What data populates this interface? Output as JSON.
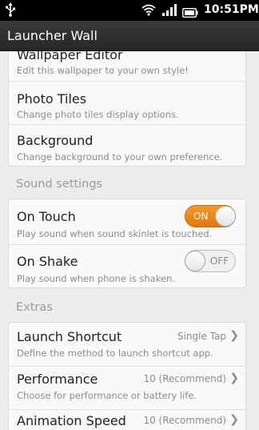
{
  "status_bar": {
    "time": "10:51PM",
    "icons": [
      "usb-icon",
      "wifi-icon",
      "signal-icon",
      "battery-icon"
    ]
  },
  "app": {
    "title": "Launcher Wall"
  },
  "wallpaper_section": {
    "items": [
      {
        "label": "Wallpaper Editor",
        "desc": "Edit this wallpaper to your own style!"
      },
      {
        "label": "Photo Tiles",
        "desc": "Change photo tiles display options."
      },
      {
        "label": "Background",
        "desc": "Change background to your own preference."
      }
    ]
  },
  "sound_section": {
    "header": "Sound settings",
    "items": [
      {
        "label": "On Touch",
        "desc": "Play sound when sound skinlet is touched.",
        "toggle": "ON",
        "enabled": true
      },
      {
        "label": "On Shake",
        "desc": "Play sound when phone is shaken.",
        "toggle": "OFF",
        "enabled": false
      }
    ]
  },
  "extras_section": {
    "header": "Extras",
    "items": [
      {
        "label": "Launch Shortcut",
        "desc": "Define the method to launch shortcut app.",
        "value": "Single Tap"
      },
      {
        "label": "Performance",
        "desc": "Choose for performance or battery life.",
        "value": "10 (Recommend)"
      },
      {
        "label": "Animation Speed",
        "desc": "",
        "value": "10 (Recommend)"
      }
    ]
  },
  "colors": {
    "accent_on": "#f08a1c",
    "background": "#ececec",
    "card": "#f9f9f9",
    "title_bar": "#2f2f2f"
  }
}
